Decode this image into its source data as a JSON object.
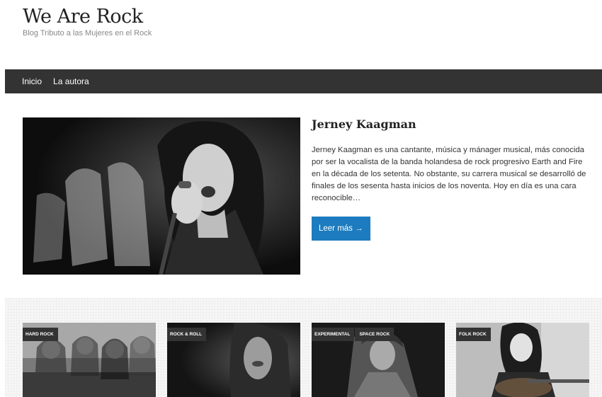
{
  "site": {
    "title": "We Are Rock",
    "description": "Blog Tributo a las Mujeres en el Rock"
  },
  "nav": {
    "items": [
      {
        "label": "Inicio"
      },
      {
        "label": "La autora"
      }
    ]
  },
  "featured": {
    "title": "Jerney Kaagman",
    "excerpt": "Jerney Kaagman es una cantante, música y mánager musical, más conocida por ser la vocalista de la banda holandesa de rock progresivo Earth and Fire en la década de los setenta. No obstante, su carrera musical se desarrolló de finales de los sesenta hasta inicios de los noventa. Hoy en día es una cara reconocible…",
    "read_more": "Leer más →",
    "accent_color": "#1c7cbf"
  },
  "cards": [
    {
      "tags": [
        "HARD ROCK"
      ]
    },
    {
      "tags": [
        "ROCK & ROLL"
      ]
    },
    {
      "tags": [
        "EXPERIMENTAL",
        "SPACE ROCK"
      ]
    },
    {
      "tags": [
        "FOLK ROCK"
      ]
    }
  ]
}
